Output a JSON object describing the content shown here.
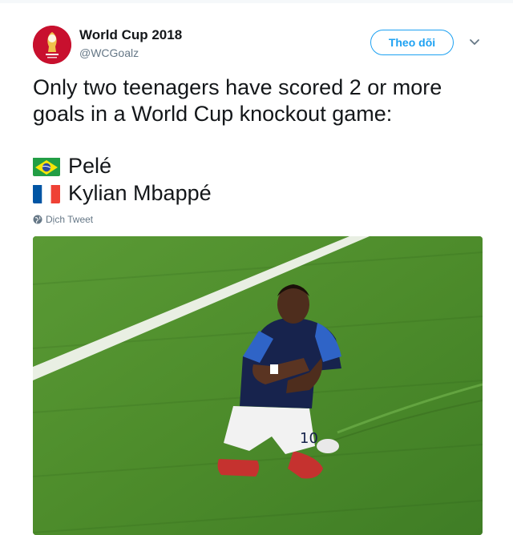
{
  "account": {
    "display_name": "World Cup 2018",
    "handle": "@WCGoalz",
    "avatar_icon": "fifa-world-cup-2018-logo",
    "avatar_color": "#c8102e"
  },
  "actions": {
    "follow_label": "Theo dõi",
    "follow_color": "#1da1f2",
    "more_icon": "chevron-down-icon"
  },
  "tweet": {
    "text": "Only two teenagers have scored 2 or more goals in a World Cup knockout game:",
    "players": [
      {
        "flag": "brazil-flag-icon",
        "name": "Pelé"
      },
      {
        "flag": "france-flag-icon",
        "name": "Kylian Mbappé"
      }
    ],
    "translate_label": "Dịch Tweet",
    "translate_icon": "globe-icon"
  },
  "media": {
    "description_icon": "photo-kneeling-footballer",
    "jersey_number": "10"
  }
}
